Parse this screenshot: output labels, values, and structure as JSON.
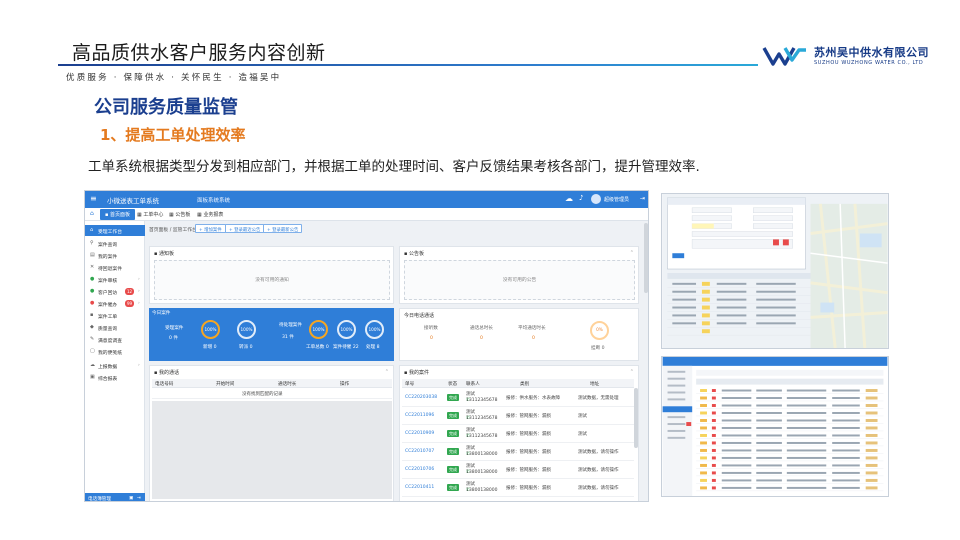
{
  "header": {
    "title": "高品质供水客户服务内容创新",
    "slogan": "优质服务 · 保障供水 · 关怀民生 · 造福吴中",
    "company_cn": "苏州吴中供水有限公司",
    "company_en": "SUZHOU WUZHONG WATER CO., LTD",
    "brand_colors": {
      "primary": "#1b3f8f",
      "accent": "#2f7fd0",
      "orange": "#e47a1f"
    }
  },
  "content": {
    "section_title": "公司服务质量监管",
    "sub_title": "1、提高工单处理效率",
    "description": "工单系统根据类型分发到相应部门，并根据工单的处理时间、客户反馈结果考核各部门，提升管理效率."
  },
  "app": {
    "title": "小微送表工单系统",
    "nav2": "面板系统系统",
    "user_name": "超级管理员",
    "icons": [
      "menu-icon",
      "cloud-icon",
      "bell-icon",
      "logout-icon",
      "home-icon"
    ],
    "tabs": {
      "active": "▪ 首页面板",
      "items": [
        "工单中心",
        "公告板",
        "业务报表"
      ]
    },
    "sidebar": [
      {
        "icon": "home-icon",
        "label": "受理工作台",
        "active": true
      },
      {
        "icon": "search-icon",
        "label": "案件查询"
      },
      {
        "icon": "file-icon",
        "label": "我的案件"
      },
      {
        "icon": "cross-icon",
        "label": "待回退案件"
      },
      {
        "icon": "gear-icon",
        "label": "案件审核"
      },
      {
        "icon": "user-icon",
        "label": "客户回访",
        "badge": "12"
      },
      {
        "icon": "alert-icon",
        "label": "案件催办",
        "badge": "99"
      },
      {
        "icon": "list-icon",
        "label": "案件工单"
      },
      {
        "icon": "chart-icon",
        "label": "质量查询"
      },
      {
        "icon": "doc-icon",
        "label": "满意度调查"
      },
      {
        "icon": "note-icon",
        "label": "我的便笺纸"
      },
      {
        "icon": "upload-icon",
        "label": "上报数据"
      },
      {
        "icon": "report-icon",
        "label": "综合报表"
      }
    ],
    "sidebar_footer": "电话簿管理",
    "breadcrumb": "首页面板 / 监管工作台",
    "crumb_buttons": [
      "+ 增加案件",
      "+ 登录最近公告",
      "+ 登录最新公告"
    ],
    "notice_panel": {
      "title": "▪ 通知板",
      "empty": "没有可用的通知"
    },
    "bulletin_panel": {
      "title": "▪ 公告板",
      "empty": "没有可用的公告"
    },
    "today_cases": {
      "title": "今日案件",
      "left_label": "受理案件",
      "left_value": "0 件",
      "rings": [
        {
          "value": "100%",
          "label": "新增 0",
          "style": "orange"
        },
        {
          "value": "100%",
          "label": "转派 0",
          "style": "white"
        }
      ],
      "mid_label": "待处理案件",
      "mid_value": "31 件",
      "rings2": [
        {
          "value": "100%",
          "label": "工单总数 0",
          "style": "orange"
        },
        {
          "value": "100%",
          "label": "案件待催 22",
          "style": "white"
        },
        {
          "value": "100%",
          "label": "处理 8",
          "style": "white"
        }
      ]
    },
    "today_calls": {
      "title": "今日电话通话",
      "stats": [
        {
          "label": "接听数",
          "value": "0"
        },
        {
          "label": "通话总时长",
          "value": "0"
        },
        {
          "label": "平均通话时长",
          "value": "0"
        }
      ],
      "ring_value": "0%",
      "ring_label": "挂断 0"
    },
    "my_calls": {
      "title": "▪ 我的通话",
      "columns": [
        "电话号码",
        "开始时间",
        "通话时长",
        "操作"
      ],
      "empty": "没有找到匹配的记录"
    },
    "my_cases": {
      "title": "▪ 我的案件",
      "columns": [
        "单号",
        "状态",
        "联系人",
        "类别",
        "地址"
      ],
      "rows": [
        {
          "id": "CC220203038",
          "status": "完成",
          "contact": "测试",
          "phone": "13112345678",
          "type": "报修：供水服务：水表故障",
          "address": "测试数据，无需处理"
        },
        {
          "id": "CC22011096",
          "status": "完成",
          "contact": "测试",
          "phone": "13112345678",
          "type": "报修：管网服务：漏损",
          "address": "测试"
        },
        {
          "id": "CC22010909",
          "status": "完成",
          "contact": "测试",
          "phone": "13112345678",
          "type": "报修：管网服务：漏损",
          "address": "测试"
        },
        {
          "id": "CC22010707",
          "status": "完成",
          "contact": "测试",
          "phone": "13800138000",
          "type": "报修：管网服务：漏损",
          "address": "测试数据，请勿操作"
        },
        {
          "id": "CC22010706",
          "status": "完成",
          "contact": "测试",
          "phone": "13800138000",
          "type": "报修：管网服务：漏损",
          "address": "测试数据，请勿操作"
        },
        {
          "id": "CC22010411",
          "status": "完成",
          "contact": "测试",
          "phone": "13800138000",
          "type": "报修：管网服务：漏损",
          "address": "测试数据，请勿操作"
        }
      ]
    }
  }
}
